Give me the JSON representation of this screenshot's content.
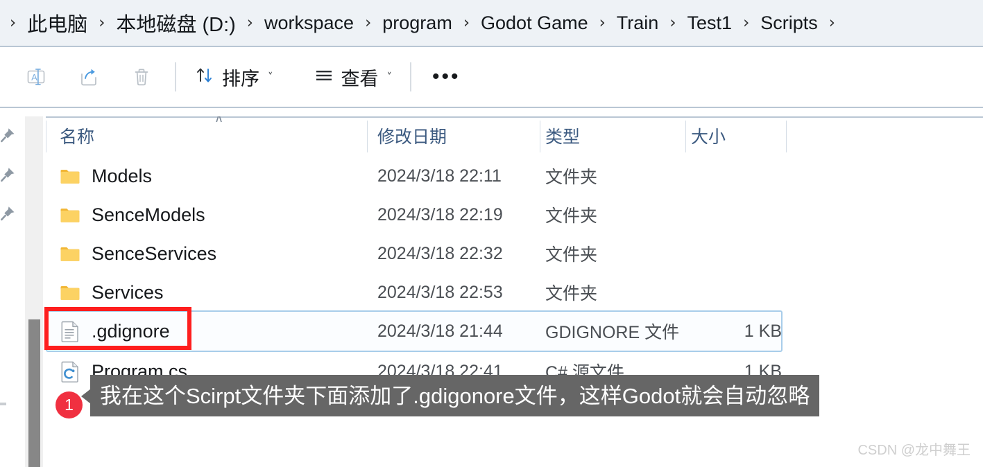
{
  "window": {
    "app": "file-explorer",
    "colors": {
      "breadcrumb_bg": "#eef2f6",
      "divider": "#b9c6d4",
      "header_text": "#3c5a80",
      "folder_icon": "#f6c64b",
      "selection_border": "#a8cdea",
      "annotation_red": "#fe1e1e",
      "badge_red": "#f03040",
      "callout_bg": "#666666",
      "scrollbar_thumb": "#878787"
    }
  },
  "breadcrumb": {
    "leading_separator": "›",
    "separator": "›",
    "items": [
      {
        "label": "此电脑"
      },
      {
        "label": "本地磁盘 (D:)"
      },
      {
        "label": "workspace"
      },
      {
        "label": "program"
      },
      {
        "label": "Godot Game"
      },
      {
        "label": "Train"
      },
      {
        "label": "Test1"
      },
      {
        "label": "Scripts"
      }
    ],
    "trailing_separator": "›"
  },
  "toolbar": {
    "rename_icon": "rename-icon",
    "share_icon": "share-icon",
    "delete_icon": "delete-icon",
    "sort_label": "排序",
    "sort_icon": "sort-arrows-icon",
    "view_label": "查看",
    "view_icon": "view-list-icon",
    "caret": "˅",
    "overflow_label": "•••"
  },
  "columns": {
    "name": "名称",
    "date_modified": "修改日期",
    "type": "类型",
    "size": "大小",
    "sort_indicator": "∧"
  },
  "files": [
    {
      "name": "Models",
      "date": "2024/3/18 22:11",
      "type": "文件夹",
      "size": "",
      "icon": "folder-icon",
      "selected": false
    },
    {
      "name": "SenceModels",
      "date": "2024/3/18 22:19",
      "type": "文件夹",
      "size": "",
      "icon": "folder-icon",
      "selected": false
    },
    {
      "name": "SenceServices",
      "date": "2024/3/18 22:32",
      "type": "文件夹",
      "size": "",
      "icon": "folder-icon",
      "selected": false
    },
    {
      "name": "Services",
      "date": "2024/3/18 22:53",
      "type": "文件夹",
      "size": "",
      "icon": "folder-icon",
      "selected": false
    },
    {
      "name": ".gdignore",
      "date": "2024/3/18 21:44",
      "type": "GDIGNORE 文件",
      "size": "1 KB",
      "icon": "text-file-icon",
      "selected": true
    },
    {
      "name": "Program.cs",
      "date": "2024/3/18 22:41",
      "type": "C# 源文件",
      "size": "1 KB",
      "icon": "csharp-file-icon",
      "selected": false
    }
  ],
  "annotation": {
    "badge_number": "1",
    "callout_text": "我在这个Scirpt文件夹下面添加了.gdigonore文件，这样Godot就会自动忽略"
  },
  "watermark": "CSDN @龙中舞王"
}
